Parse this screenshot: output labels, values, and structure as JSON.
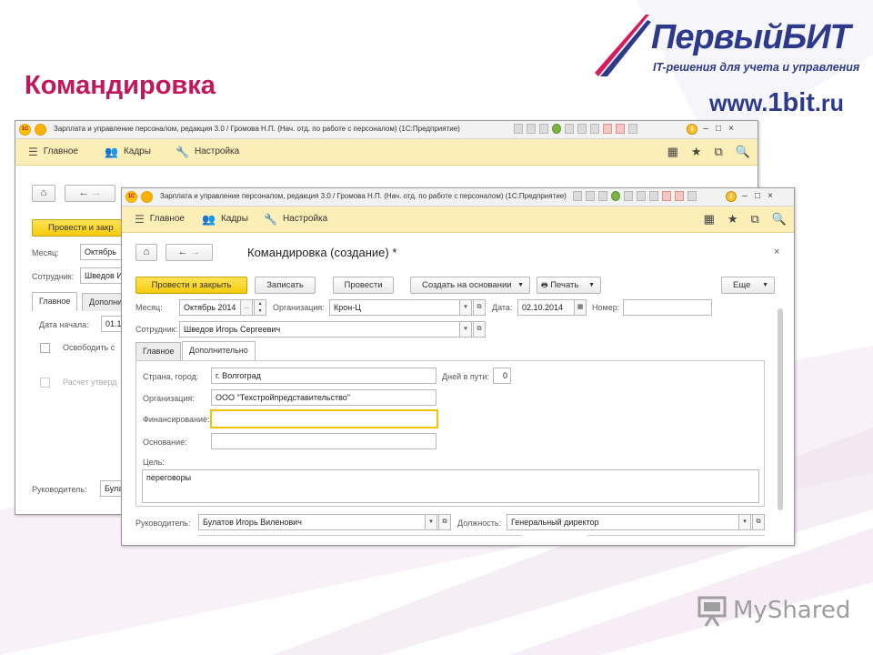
{
  "slide": {
    "title": "Командировка"
  },
  "logo": {
    "name": "ПервыйБИТ",
    "tagline": "IT-решения для учета и управления",
    "url_prefix": "www.",
    "url_main": "1bit",
    "url_suffix": ".ru",
    "color": "#2d3a8c"
  },
  "watermark": {
    "text": "MyShared"
  },
  "back_window": {
    "title": "Зарплата и управление персоналом, редакция 3.0 / Громова Н.П. (Нач. отд. по работе с персоналом) (1С:Предприятие)",
    "menu": [
      "Главное",
      "Кадры",
      "Настройка"
    ],
    "post_close_button": "Провести и закр",
    "month_label": "Месяц:",
    "month_value": "Октябрь",
    "employee_label": "Сотрудник:",
    "employee_value": "Шведов И",
    "tabs": [
      "Главное",
      "Дополни"
    ],
    "start_date_label": "Дата начала:",
    "start_date_value": "01.1",
    "release_label": "Освободить с",
    "calc_label": "Расчет утверд",
    "manager_label": "Руководитель:",
    "manager_value": "Була"
  },
  "front_window": {
    "title": "Зарплата и управление персоналом, редакция 3.0 / Громова Н.П. (Нач. отд. по работе с персоналом) (1С:Предприятие)",
    "menu": [
      "Главное",
      "Кадры",
      "Настройка"
    ],
    "doc_title": "Командировка (создание) *",
    "buttons": {
      "post_close": "Провести и закрыть",
      "save": "Записать",
      "post": "Провести",
      "create_based": "Создать на основании",
      "print": "Печать",
      "more": "Еще"
    },
    "month_label": "Месяц:",
    "month_value": "Октябрь 2014",
    "org_label": "Организация:",
    "org_value": "Крон-Ц",
    "date_label": "Дата:",
    "date_value": "02.10.2014",
    "number_label": "Номер:",
    "number_value": "",
    "employee_label": "Сотрудник:",
    "employee_value": "Шведов Игорь Сергеевич",
    "tabs": [
      "Главное",
      "Дополнительно"
    ],
    "country_label": "Страна, город:",
    "country_value": "г. Волгоград",
    "days_label": "Дней в пути:",
    "days_value": "0",
    "organization_label": "Организация:",
    "organization_value": "ООО \"Техстройпредставительство\"",
    "financing_label": "Финансирование:",
    "financing_value": "",
    "basis_label": "Основание:",
    "basis_value": "",
    "goal_label": "Цель:",
    "goal_value": "переговоры",
    "manager_label": "Руководитель:",
    "manager_value": "Булатов Игорь Виленович",
    "position_label": "Должность:",
    "position_value": "Генеральный директор"
  },
  "colors": {
    "title_pink": "#c2185b",
    "menu_yellow": "#fbeeb7",
    "button_yellow": "#f5cb0b"
  }
}
